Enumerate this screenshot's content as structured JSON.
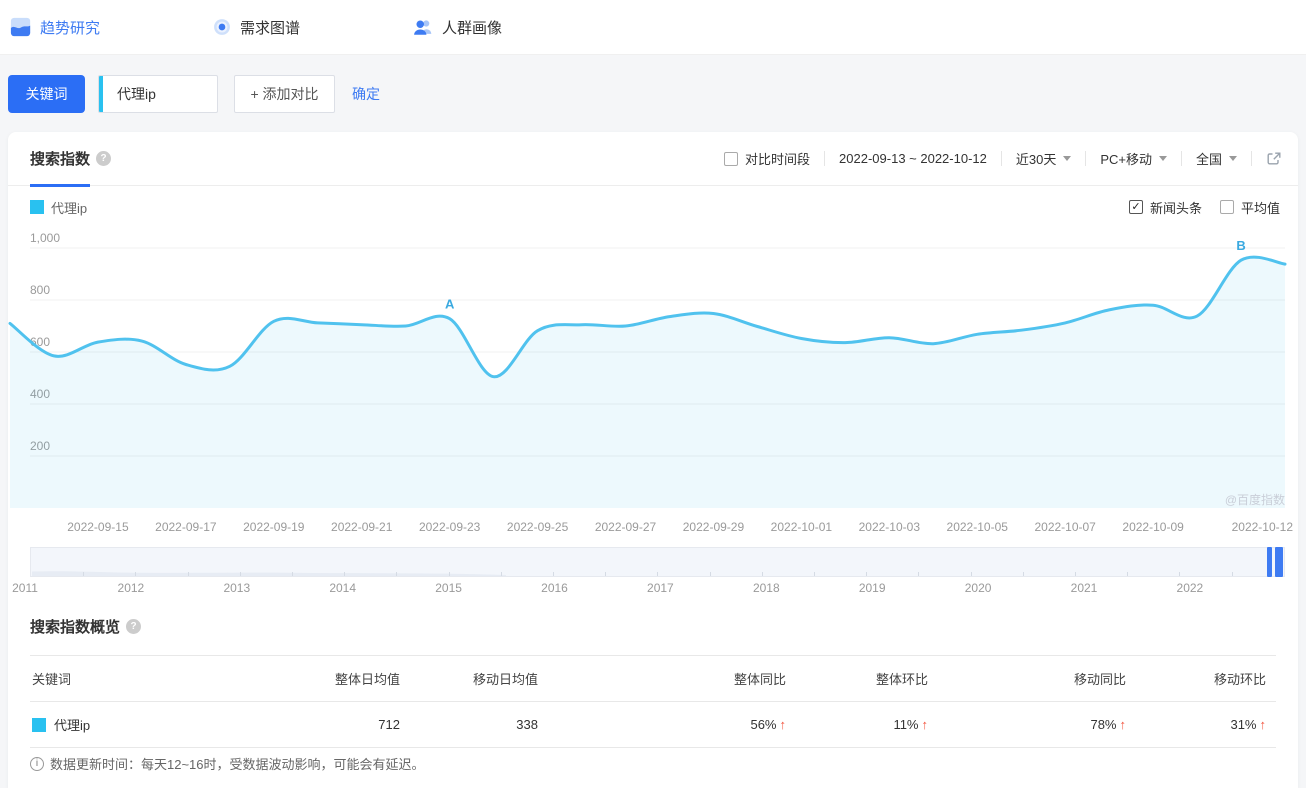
{
  "nav": {
    "items": [
      {
        "label": "趋势研究",
        "active": true
      },
      {
        "label": "需求图谱",
        "active": false
      },
      {
        "label": "人群画像",
        "active": false
      }
    ]
  },
  "search_bar": {
    "keyword_button": "关键词",
    "keyword_value": "代理ip",
    "add_compare": "+ 添加对比",
    "confirm": "确定"
  },
  "chart_panel": {
    "tab": "搜索指数",
    "compare_label": "对比时间段",
    "date_range": "2022-09-13 ~ 2022-10-12",
    "period": "近30天",
    "device": "PC+移动",
    "region": "全国",
    "legend_label": "代理ip",
    "legend_color": "#29c1f0",
    "news_toggle": "新闻头条",
    "avg_toggle": "平均值",
    "watermark": "@百度指数"
  },
  "chart_data": {
    "type": "area",
    "title": "搜索指数",
    "x": [
      "2022-09-13",
      "2022-09-14",
      "2022-09-15",
      "2022-09-16",
      "2022-09-17",
      "2022-09-18",
      "2022-09-19",
      "2022-09-20",
      "2022-09-21",
      "2022-09-22",
      "2022-09-23",
      "2022-09-24",
      "2022-09-25",
      "2022-09-26",
      "2022-09-27",
      "2022-09-28",
      "2022-09-29",
      "2022-09-30",
      "2022-10-01",
      "2022-10-02",
      "2022-10-03",
      "2022-10-04",
      "2022-10-05",
      "2022-10-06",
      "2022-10-07",
      "2022-10-08",
      "2022-10-09",
      "2022-10-10",
      "2022-10-11",
      "2022-10-12"
    ],
    "series": [
      {
        "name": "代理ip",
        "color": "#50c2ee",
        "fill": "rgba(80,194,238,0.10)",
        "values": [
          710,
          585,
          638,
          642,
          552,
          545,
          718,
          712,
          705,
          700,
          728,
          505,
          682,
          705,
          700,
          736,
          748,
          698,
          652,
          636,
          655,
          632,
          668,
          684,
          712,
          762,
          780,
          738,
          953,
          938
        ]
      }
    ],
    "ylim": [
      0,
      1000
    ],
    "yticks": [
      200,
      400,
      600,
      800,
      1000
    ],
    "x_tick_indices": [
      2,
      4,
      6,
      8,
      10,
      12,
      14,
      16,
      18,
      20,
      22,
      24,
      26,
      29
    ],
    "annotations": [
      {
        "label": "A",
        "index": 10
      },
      {
        "label": "B",
        "index": 28
      }
    ],
    "grid": true,
    "legend_position": "top-left"
  },
  "timeline": {
    "years": [
      "2011",
      "2012",
      "2013",
      "2014",
      "2015",
      "2016",
      "2017",
      "2018",
      "2019",
      "2020",
      "2021",
      "2022"
    ]
  },
  "overview": {
    "title": "搜索指数概览",
    "columns": [
      "关键词",
      "整体日均值",
      "移动日均值",
      "整体同比",
      "整体环比",
      "移动同比",
      "移动环比"
    ],
    "row": {
      "keyword": "代理ip",
      "keyword_color": "#29c1f0",
      "overall_avg": "712",
      "mobile_avg": "338",
      "overall_yoy": "56%",
      "overall_mom": "11%",
      "mobile_yoy": "78%",
      "mobile_mom": "31%"
    },
    "up_arrow": "↑"
  },
  "footer_note": "数据更新时间：每天12~16时，受数据波动影响，可能会有延迟。",
  "icons": {
    "help": "?",
    "info": "i",
    "check": "✓"
  }
}
